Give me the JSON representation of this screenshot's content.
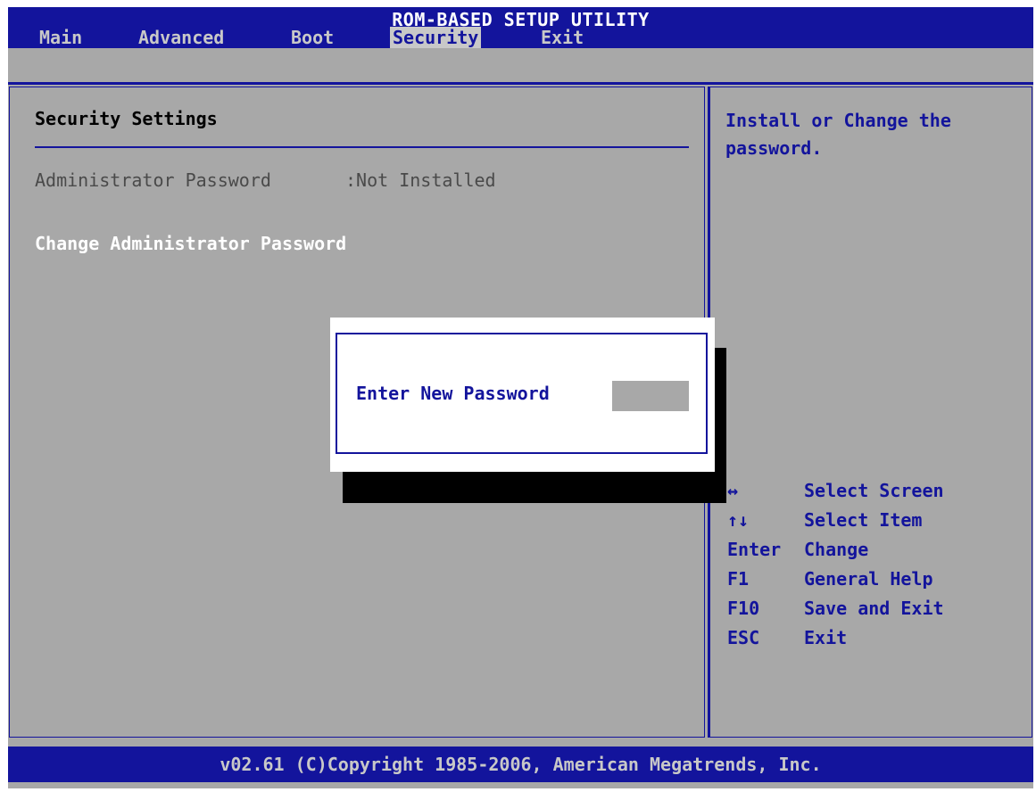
{
  "title": "ROM-BASED SETUP UTILITY",
  "menu": {
    "items": [
      {
        "label": "Main"
      },
      {
        "label": "Advanced"
      },
      {
        "label": "Boot"
      },
      {
        "label": "Security"
      },
      {
        "label": "Exit"
      }
    ],
    "active": "Security"
  },
  "left": {
    "section_title": "Security Settings",
    "admin_password_label": "Administrator Password",
    "admin_password_status": ":Not Installed",
    "change_admin_password": "Change Administrator Password"
  },
  "help": {
    "text": "Install or Change the password."
  },
  "keys": [
    {
      "key": "↔",
      "desc": "Select Screen"
    },
    {
      "key": "↑↓",
      "desc": "Select Item"
    },
    {
      "key": "Enter",
      "desc": "Change"
    },
    {
      "key": "F1",
      "desc": "General Help"
    },
    {
      "key": "F10",
      "desc": "Save and Exit"
    },
    {
      "key": "ESC",
      "desc": "Exit"
    }
  ],
  "dialog": {
    "label": "Enter New Password",
    "value": ""
  },
  "footer": "v02.61 (C)Copyright 1985-2006, American Megatrends, Inc.",
  "colors": {
    "blue": "#13149c",
    "gray": "#a8a8a8",
    "white": "#ffffff"
  }
}
